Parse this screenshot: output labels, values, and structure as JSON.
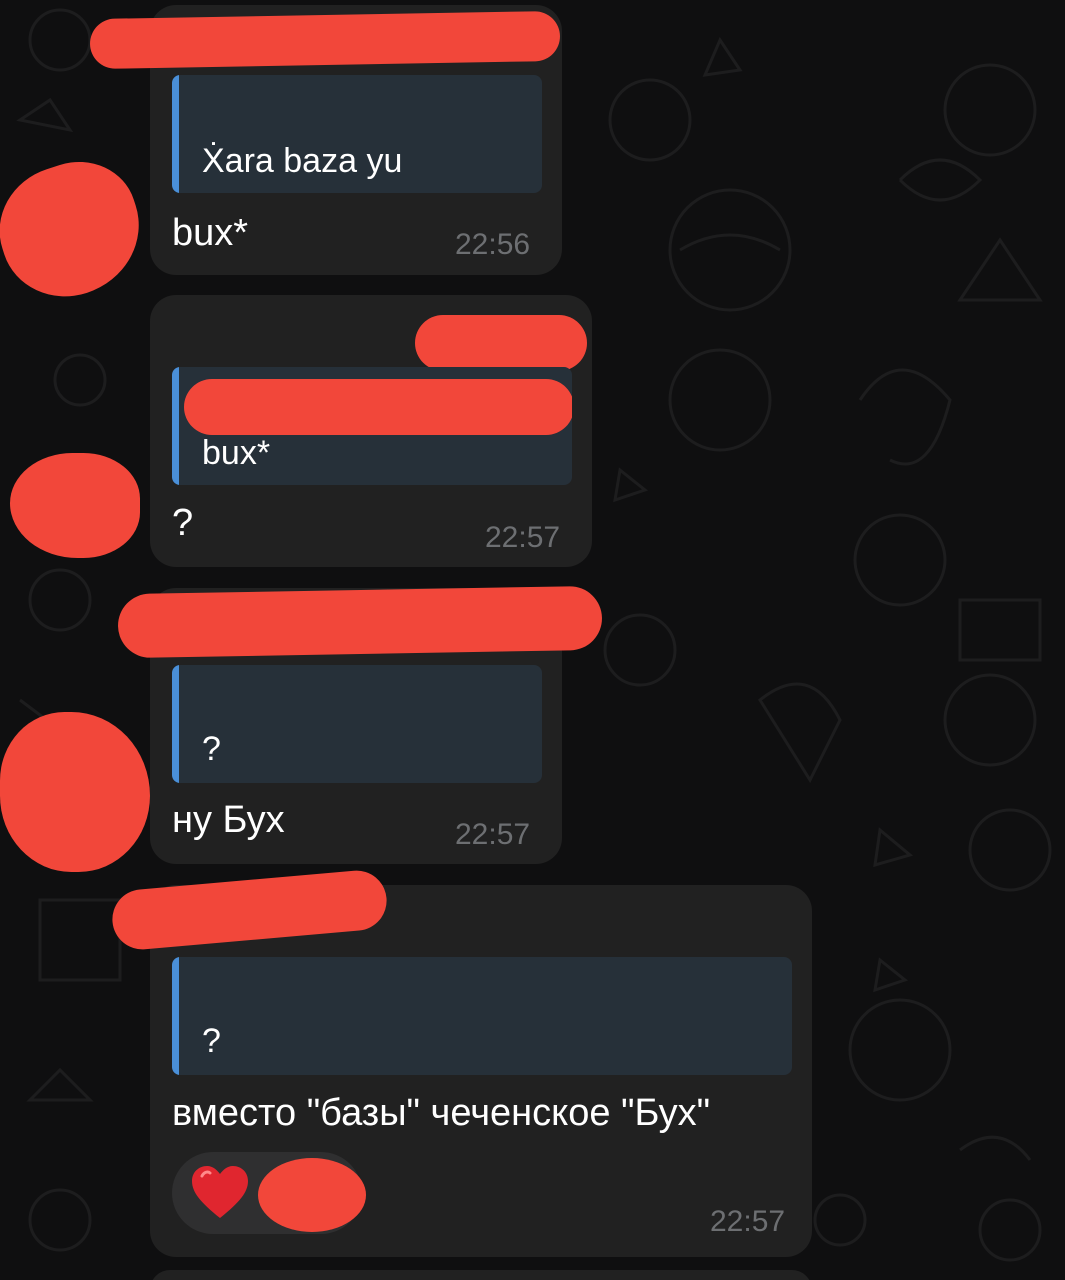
{
  "messages": [
    {
      "quote": "Ẋara baza yu",
      "text": "bux*",
      "time": "22:56"
    },
    {
      "quote": "bux*",
      "text": "?",
      "time": "22:57"
    },
    {
      "quote": "?",
      "text": "ну Бух",
      "time": "22:57"
    },
    {
      "quote": "?",
      "text": "вместо \"базы\" чеченское \"Бух\"",
      "time": "22:57",
      "reaction": "heart-icon"
    }
  ],
  "colors": {
    "bubble": "#212121",
    "quote_bg": "#263039",
    "quote_bar": "#4a8fd8",
    "redaction": "#f2473a",
    "time": "#6d6f72"
  }
}
